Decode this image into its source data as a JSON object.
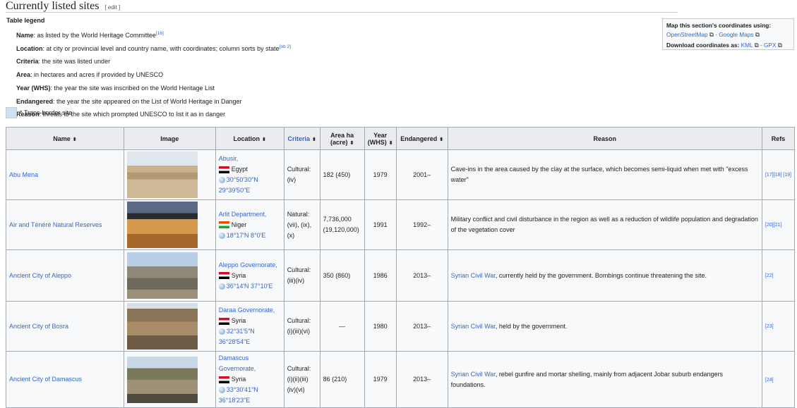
{
  "section": {
    "title": "Currently listed sites",
    "edit": "[ edit ]"
  },
  "legend": {
    "title": "Table legend",
    "items": [
      {
        "term": "Name",
        "desc": ": as listed by the World Heritage Committee",
        "ref": "[16]"
      },
      {
        "term": "Location",
        "desc": ": at city or provincial level and country name, with coordinates; column sorts by state",
        "ref": "[nb 2]"
      },
      {
        "term": "Criteria",
        "desc": ": the site was listed under",
        "ref": ""
      },
      {
        "term": "Area",
        "desc": ": in hectares and acres if provided by UNESCO",
        "ref": ""
      },
      {
        "term": "Year (WHS)",
        "desc": ": the year the site was inscribed on the World Heritage List",
        "ref": ""
      },
      {
        "term": "Endangered",
        "desc": ": the year the site appeared on the List of World Heritage in Danger",
        "ref": ""
      },
      {
        "term": "Reason",
        "desc": ": threats to the site which prompted UNESCO to list it as in danger",
        "ref": ""
      }
    ],
    "transborder": "* Trans-border site"
  },
  "coords": {
    "map_label": "Map this section's coordinates using:",
    "osm": "OpenStreetMap",
    "gmaps": "Google Maps",
    "dl_label": "Download coordinates as:",
    "kml": "KML",
    "gpx": "GPX",
    "sep": "·"
  },
  "table": {
    "headers": [
      "Name",
      "Image",
      "Location",
      "Criteria",
      "Area ha (acre)",
      "Year (WHS)",
      "Endangered",
      "Reason",
      "Refs"
    ],
    "rows": [
      {
        "name": "Abu Mena",
        "place": "Abusir,",
        "country": "Egypt",
        "flag": "eg",
        "coord1": "30°50′30″N",
        "coord2": "29°39′50″E",
        "criteria": "Cultural: (iv)",
        "area": "182 (450)",
        "year": "1979",
        "endangered": "2001–",
        "reason_link": "",
        "reason": "Cave-ins in the area caused by the clay at the surface, which becomes semi-liquid when met with \"excess water\"",
        "refs": "[17][18] [19]"
      },
      {
        "name": "Air and Ténéré Natural Reserves",
        "place": "Arlit Department,",
        "country": "Niger",
        "flag": "ni",
        "coord1": "18°17′N 8°0′E",
        "coord2": "",
        "criteria": "Natural: (vii), (ix), (x)",
        "area": "7,736,000 (19,120,000)",
        "year": "1991",
        "endangered": "1992–",
        "reason_link": "",
        "reason": "Military conflict and civil disturbance in the region as well as a reduction of wildlife population and degradation of the vegetation cover",
        "refs": "[20][21]"
      },
      {
        "name": "Ancient City of Aleppo",
        "place": "Aleppo Governorate,",
        "country": "Syria",
        "flag": "sy",
        "coord1": "36°14′N 37°10′E",
        "coord2": "",
        "criteria": "Cultural: (iii)(iv)",
        "area": "350 (860)",
        "year": "1986",
        "endangered": "2013–",
        "reason_link": "Syrian Civil War",
        "reason": ", currently held by the government. Bombings continue threatening the site.",
        "refs": "[22]"
      },
      {
        "name": "Ancient City of Bosra",
        "place": "Daraa Governorate,",
        "country": "Syria",
        "flag": "sy",
        "coord1": "32°31′5″N",
        "coord2": "36°28′54″E",
        "criteria": "Cultural: (i)(iii)(vi)",
        "area": "—",
        "year": "1980",
        "endangered": "2013–",
        "reason_link": "Syrian Civil War",
        "reason": ", held by the government.",
        "refs": "[23]"
      },
      {
        "name": "Ancient City of Damascus",
        "place": "Damascus Governorate,",
        "country": "Syria",
        "flag": "sy",
        "coord1": "33°30′41″N",
        "coord2": "36°18′23″E",
        "criteria": "Cultural: (i)(ii)(iii) (iv)(vi)",
        "area": "86 (210)",
        "year": "1979",
        "endangered": "2013–",
        "reason_link": "Syrian Civil War",
        "reason": ", rebel gunfire and mortar shelling, mainly from adjacent Jobar suburb endangers foundations.",
        "refs": "[24]"
      }
    ]
  }
}
